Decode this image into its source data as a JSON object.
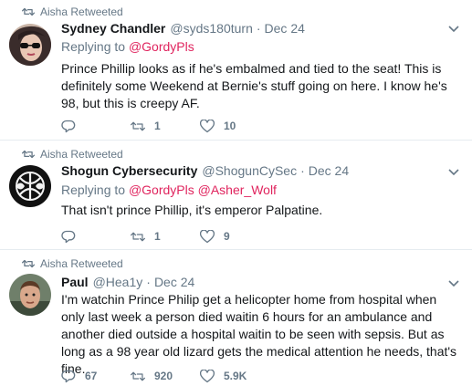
{
  "colors": {
    "accent": "#e0245e",
    "muted": "#657786",
    "text": "#14171a",
    "divider": "#e6ecf0"
  },
  "tweets": [
    {
      "retweeted_by": "Aisha Retweeted",
      "name": "Sydney Chandler",
      "handle": "@syds180turn",
      "dot": "·",
      "date": "Dec 24",
      "replying_prefix": "Replying to",
      "mentions": [
        "@GordyPls"
      ],
      "text": "Prince Phillip looks as if he's embalmed and tied to the seat! This is definitely some Weekend at Bernie's stuff going on here. I know he's 98, but this is creepy AF.",
      "reply_count": "",
      "retweet_count": "1",
      "like_count": "10",
      "avatar_icon": "woman-sunglasses-avatar"
    },
    {
      "retweeted_by": "Aisha Retweeted",
      "name": "Shogun Cybersecurity",
      "handle": "@ShogunCySec",
      "dot": "·",
      "date": "Dec 24",
      "replying_prefix": "Replying to",
      "mentions": [
        "@GordyPls",
        "@Asher_Wolf"
      ],
      "text": "That isn't prince Phillip, it's emperor Palpatine.",
      "reply_count": "",
      "retweet_count": "1",
      "like_count": "9",
      "avatar_icon": "shogun-logo-avatar"
    },
    {
      "retweeted_by": "Aisha Retweeted",
      "name": "Paul",
      "handle": "@Hea1y",
      "dot": "·",
      "date": "Dec 24",
      "text": "I'm watchin Prince Philip get a helicopter home from hospital when only last week a person died waitin 6 hours for an ambulance and another died outside a hospital waitin to be seen with sepsis. But as long as a 98 year old lizard gets the medical attention he needs, that's fine.",
      "reply_count": "67",
      "retweet_count": "920",
      "like_count": "5.9K",
      "avatar_icon": "man-avatar"
    }
  ]
}
